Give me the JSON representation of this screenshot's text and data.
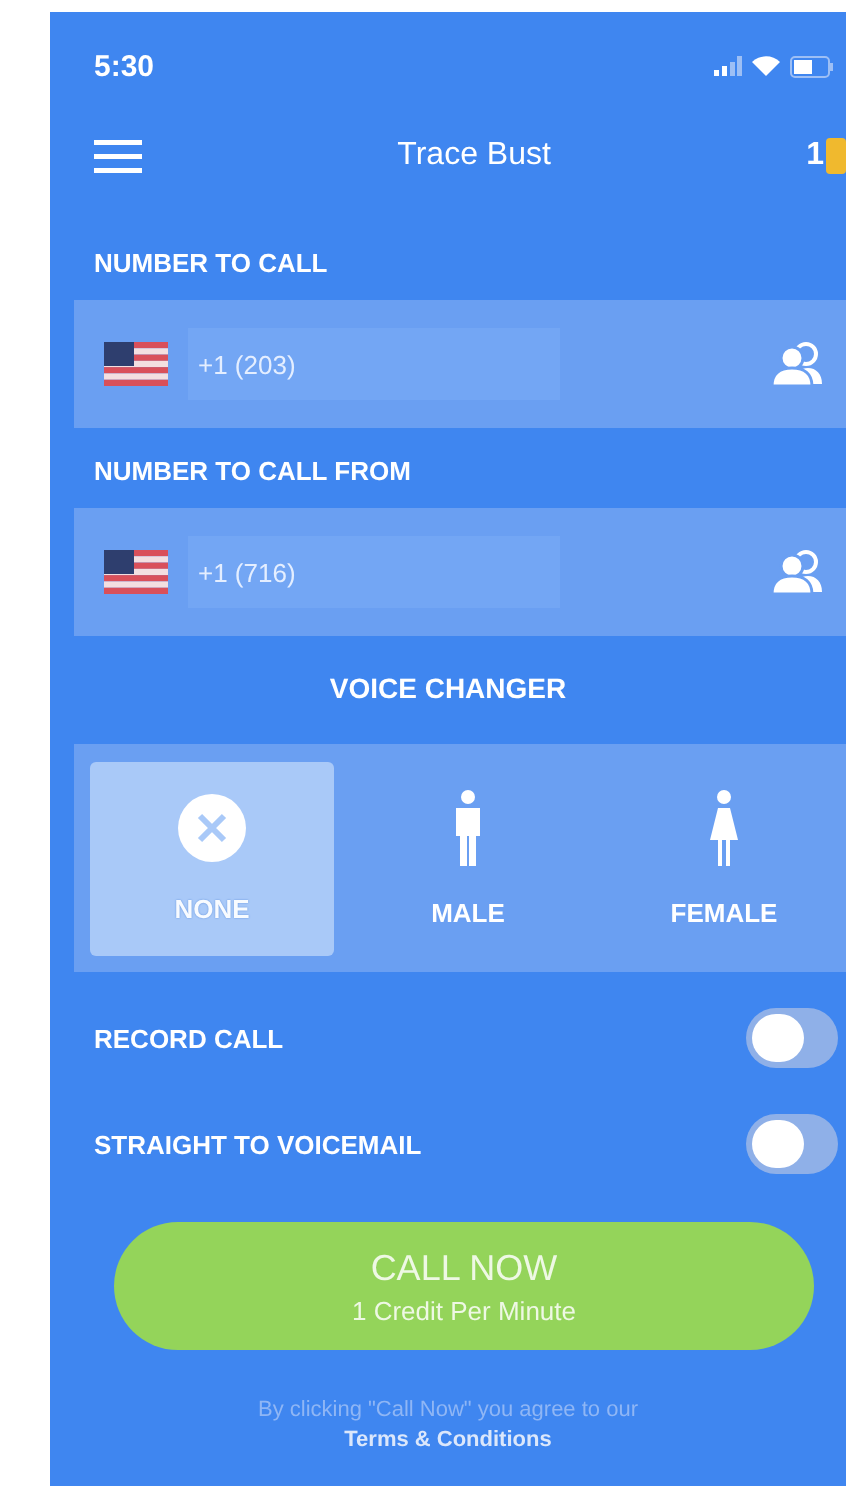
{
  "status_bar": {
    "time": "5:30"
  },
  "header": {
    "title": "Trace Bust",
    "credits": "1"
  },
  "number_fields": [
    {
      "label": "NUMBER TO CALL",
      "value": "+1 (203)"
    },
    {
      "label": "NUMBER TO CALL FROM",
      "value": "+1 (716)"
    }
  ],
  "voice_changer": {
    "title": "VOICE CHANGER",
    "options": [
      {
        "kind": "none",
        "label": "NONE",
        "selected": true
      },
      {
        "kind": "male",
        "label": "MALE",
        "selected": false
      },
      {
        "kind": "female",
        "label": "FEMALE",
        "selected": false
      }
    ]
  },
  "toggles": [
    {
      "label": "RECORD CALL",
      "on": false
    },
    {
      "label": "STRAIGHT TO VOICEMAIL",
      "on": false
    }
  ],
  "call_button": {
    "label": "CALL NOW",
    "sublabel": "1 Credit Per Minute"
  },
  "disclaimer": "By clicking \"Call Now\" you agree to our",
  "terms_link": "Terms & Conditions"
}
